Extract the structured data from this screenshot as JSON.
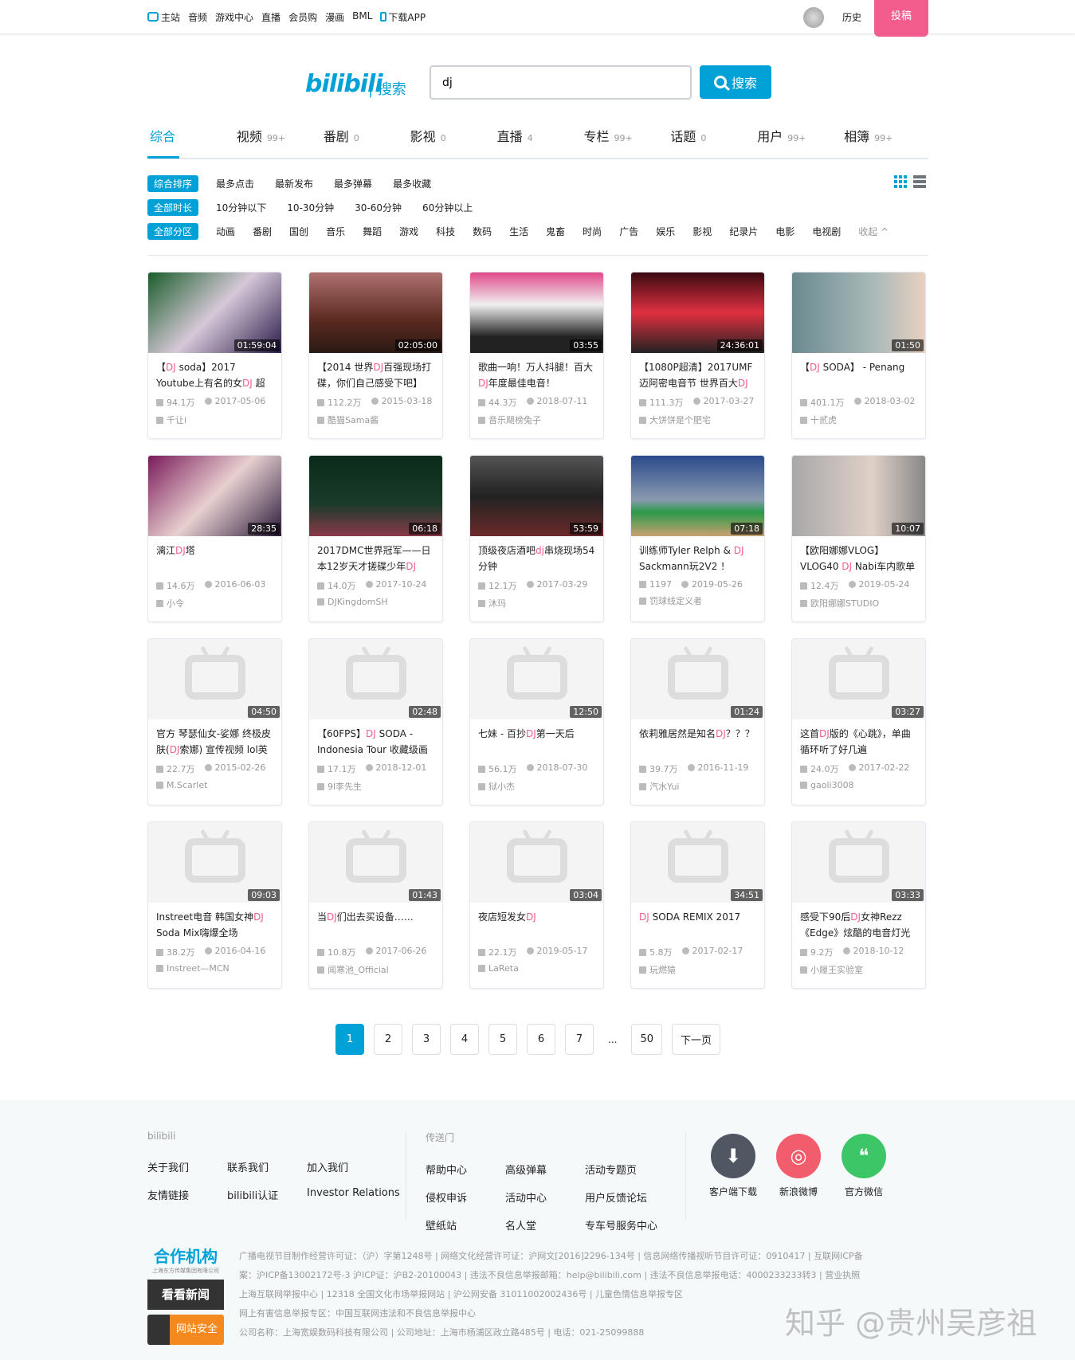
{
  "topnav": {
    "items": [
      "主站",
      "音频",
      "游戏中心",
      "直播",
      "会员购",
      "漫画",
      "BML",
      "下载APP"
    ],
    "history": "历史",
    "upload": "投稿"
  },
  "search": {
    "logo": "bilibili",
    "logo_sub": "| 搜索",
    "query": "dj",
    "button": "搜索"
  },
  "tabs": [
    {
      "label": "综合",
      "count": ""
    },
    {
      "label": "视频",
      "count": "99+"
    },
    {
      "label": "番剧",
      "count": "0"
    },
    {
      "label": "影视",
      "count": "0"
    },
    {
      "label": "直播",
      "count": "4"
    },
    {
      "label": "专栏",
      "count": "99+"
    },
    {
      "label": "话题",
      "count": "0"
    },
    {
      "label": "用户",
      "count": "99+"
    },
    {
      "label": "相簿",
      "count": "99+"
    }
  ],
  "filters": {
    "order": {
      "active": "综合排序",
      "options": [
        "最多点击",
        "最新发布",
        "最多弹幕",
        "最多收藏"
      ]
    },
    "duration": {
      "active": "全部时长",
      "options": [
        "10分钟以下",
        "10-30分钟",
        "30-60分钟",
        "60分钟以上"
      ]
    },
    "zone": {
      "active": "全部分区",
      "options": [
        "动画",
        "番剧",
        "国创",
        "音乐",
        "舞蹈",
        "游戏",
        "科技",
        "数码",
        "生活",
        "鬼畜",
        "时尚",
        "广告",
        "娱乐",
        "影视",
        "纪录片",
        "电影",
        "电视剧"
      ],
      "fold": "收起 ^"
    }
  },
  "highlight_color": "#f25d8e",
  "accent_color": "#00a1d6",
  "videos": [
    {
      "title": [
        "【",
        "DJ",
        " soda】2017 Youtube上有名的女",
        "DJ",
        " 超好听"
      ],
      "duration": "01:59:04",
      "plays": "94.1万",
      "date": "2017-05-06",
      "uploader": "千让i",
      "thumb": "linear-gradient(135deg,#1a5d2a,#d6c8d8 50%,#2a1a4a)"
    },
    {
      "title": [
        "【2014 世界",
        "DJ",
        "百强现场打碟，你们自己感受下吧】"
      ],
      "duration": "02:05:00",
      "plays": "112.2万",
      "date": "2015-03-18",
      "uploader": "酷猫Sama酱",
      "thumb": "linear-gradient(180deg,#b07070,#5a2a20 60%,#2a1a14)"
    },
    {
      "title": [
        "歌曲一响！万人抖腿！百大",
        "DJ",
        "年度最佳电音！"
      ],
      "duration": "03:55",
      "plays": "44.3万",
      "date": "2018-07-11",
      "uploader": "音乐飓榜兔子",
      "thumb": "linear-gradient(180deg,#e04a8a,#f0f0f0 40%,#222 80%)"
    },
    {
      "title": [
        "【1080P超清】2017UMF迈阿密电音节 世界百大",
        "DJ"
      ],
      "duration": "24:36:01",
      "plays": "111.3万",
      "date": "2017-03-27",
      "uploader": "大饼饼是个肥宅",
      "thumb": "linear-gradient(180deg,#3a0a10,#e03040 50%,#222)"
    },
    {
      "title": [
        "【",
        "DJ",
        " SODA】 - Penang"
      ],
      "duration": "01:50",
      "plays": "401.1万",
      "date": "2018-03-02",
      "uploader": "十贰虎",
      "thumb": "linear-gradient(90deg,#6a8a90,#a8b8b8 60%,#e8d0c0)"
    },
    {
      "title": [
        "漓江",
        "DJ",
        "塔"
      ],
      "duration": "28:35",
      "plays": "14.6万",
      "date": "2016-06-03",
      "uploader": "小令",
      "thumb": "linear-gradient(135deg,#7a1a5a,#e8d0d0 50%,#2a1a3a)"
    },
    {
      "title": [
        "2017DMC世界冠军——日本12岁天才搓碟少年",
        "DJ"
      ],
      "duration": "06:18",
      "plays": "14.0万",
      "date": "2017-10-24",
      "uploader": "DJKingdomSH",
      "thumb": "linear-gradient(180deg,#0a2a1a,#1a3a2a 60%,#8a3a4a)"
    },
    {
      "title": [
        "顶级夜店酒吧",
        "dj",
        "串烧现场54分钟"
      ],
      "duration": "53:59",
      "plays": "12.1万",
      "date": "2017-03-29",
      "uploader": "沐玛",
      "thumb": "linear-gradient(180deg,#555,#222 50%,#6a2a2a)"
    },
    {
      "title": [
        "训练师Tyler Relph & ",
        "DJ",
        " Sackmann玩2V2 ！"
      ],
      "duration": "07:18",
      "plays": "1197",
      "date": "2019-05-26",
      "uploader": "罚球线定义者",
      "thumb": "linear-gradient(180deg,#2a4a8a,#8a9ab0 55%,#2a9a4a 70%,#c8a070)"
    },
    {
      "title": [
        "【欧阳娜娜VLOG】VLOG40 ",
        "DJ",
        " Nabi车内歌单"
      ],
      "duration": "10:07",
      "plays": "12.4万",
      "date": "2019-05-24",
      "uploader": "欧阳娜娜STUDIO",
      "thumb": "linear-gradient(90deg,#a8a8a8,#e0d0c8 60%,#888)"
    },
    {
      "title": [
        "官方 琴瑟仙女-娑娜 终极皮肤(",
        "DJ",
        "索娜) 宣传视频 lol英"
      ],
      "duration": "04:50",
      "plays": "22.7万",
      "date": "2015-02-26",
      "uploader": "M.Scarlet",
      "thumb": ""
    },
    {
      "title": [
        "【60FPS】",
        "DJ",
        " SODA - Indonesia Tour 收藏级画质"
      ],
      "duration": "02:48",
      "plays": "17.1万",
      "date": "2018-12-01",
      "uploader": "9l李先生",
      "thumb": ""
    },
    {
      "title": [
        "七妹 - 百抄",
        "DJ",
        "第一天后"
      ],
      "duration": "12:50",
      "plays": "56.1万",
      "date": "2018-07-30",
      "uploader": "狱小杰",
      "thumb": ""
    },
    {
      "title": [
        "依莉雅居然是知名",
        "DJ",
        "？？？"
      ],
      "duration": "01:24",
      "plays": "39.7万",
      "date": "2016-11-19",
      "uploader": "汽水Yui",
      "thumb": ""
    },
    {
      "title": [
        "这首",
        "DJ",
        "版的《心跳》，单曲循环听了好几遍"
      ],
      "duration": "03:27",
      "plays": "24.0万",
      "date": "2017-02-22",
      "uploader": "gaoli3008",
      "thumb": ""
    },
    {
      "title": [
        "Instreet电音 韩国女神",
        "DJ",
        " Soda Mix嗨爆全场"
      ],
      "duration": "09:03",
      "plays": "38.2万",
      "date": "2016-04-16",
      "uploader": "Instreet—MCN",
      "thumb": ""
    },
    {
      "title": [
        "当",
        "DJ",
        "们出去买设备……"
      ],
      "duration": "01:43",
      "plays": "10.8万",
      "date": "2017-06-26",
      "uploader": "闻寒池_Official",
      "thumb": ""
    },
    {
      "title": [
        "夜店短发女",
        "DJ"
      ],
      "duration": "03:04",
      "plays": "22.1万",
      "date": "2019-05-17",
      "uploader": "LaReta",
      "thumb": ""
    },
    {
      "title": [
        "",
        "DJ",
        " SODA REMIX 2017"
      ],
      "duration": "34:51",
      "plays": "5.8万",
      "date": "2017-02-17",
      "uploader": "玩燃猿",
      "thumb": ""
    },
    {
      "title": [
        "感受下90后",
        "DJ",
        "女神Rezz《Edge》炫酷的电音灯光"
      ],
      "duration": "03:33",
      "plays": "9.2万",
      "date": "2018-10-12",
      "uploader": "小履王实验室",
      "thumb": ""
    }
  ],
  "pager": {
    "pages": [
      "1",
      "2",
      "3",
      "4",
      "5",
      "6",
      "7"
    ],
    "ellipsis": "...",
    "last": "50",
    "next": "下一页"
  },
  "footer": {
    "col1": {
      "head": "bilibili",
      "links": [
        "关于我们",
        "联系我们",
        "加入我们",
        "友情链接",
        "bilibili认证",
        "Investor Relations"
      ]
    },
    "col2": {
      "head": "传送门",
      "links": [
        "帮助中心",
        "高级弹幕",
        "活动专题页",
        "侵权申诉",
        "活动中心",
        "用户反馈论坛",
        "壁纸站",
        "名人堂",
        "专车号服务中心"
      ]
    },
    "social": [
      {
        "label": "客户端下载",
        "color": "#505763",
        "icon": "⬇"
      },
      {
        "label": "新浪微博",
        "color": "#f25d6e",
        "icon": "◎"
      },
      {
        "label": "官方微信",
        "color": "#3cc668",
        "icon": "❝"
      }
    ],
    "partner": {
      "title": "合作机构",
      "sub": "上海东方传媒集团有限公司",
      "kk": "看看新闻",
      "safe": "网站安全"
    },
    "license": [
      "广播电视节目制作经营许可证：（沪）字第1248号 | 网络文化经营许可证：沪网文[2016]2296-134号 | 信息网络传播视听节目许可证：0910417 | 互联网ICP备案：沪ICP备13002172号-3 沪ICP证：沪B2-20100043 | 违法不良信息举报邮箱：help@bilibili.com | 违法不良信息举报电话：4000233233转3 | 营业执照",
      "上海互联网举报中心 | 12318 全国文化市场举报网站 | 沪公网安备 31011002002436号 | 儿童色情信息举报专区",
      "网上有害信息举报专区：中国互联网违法和不良信息举报中心",
      "公司名称：上海宽娱数码科技有限公司 | 公司地址：上海市杨浦区政立路485号 | 电话：021-25099888"
    ]
  },
  "watermark": "知乎 @贵州吴彦祖"
}
